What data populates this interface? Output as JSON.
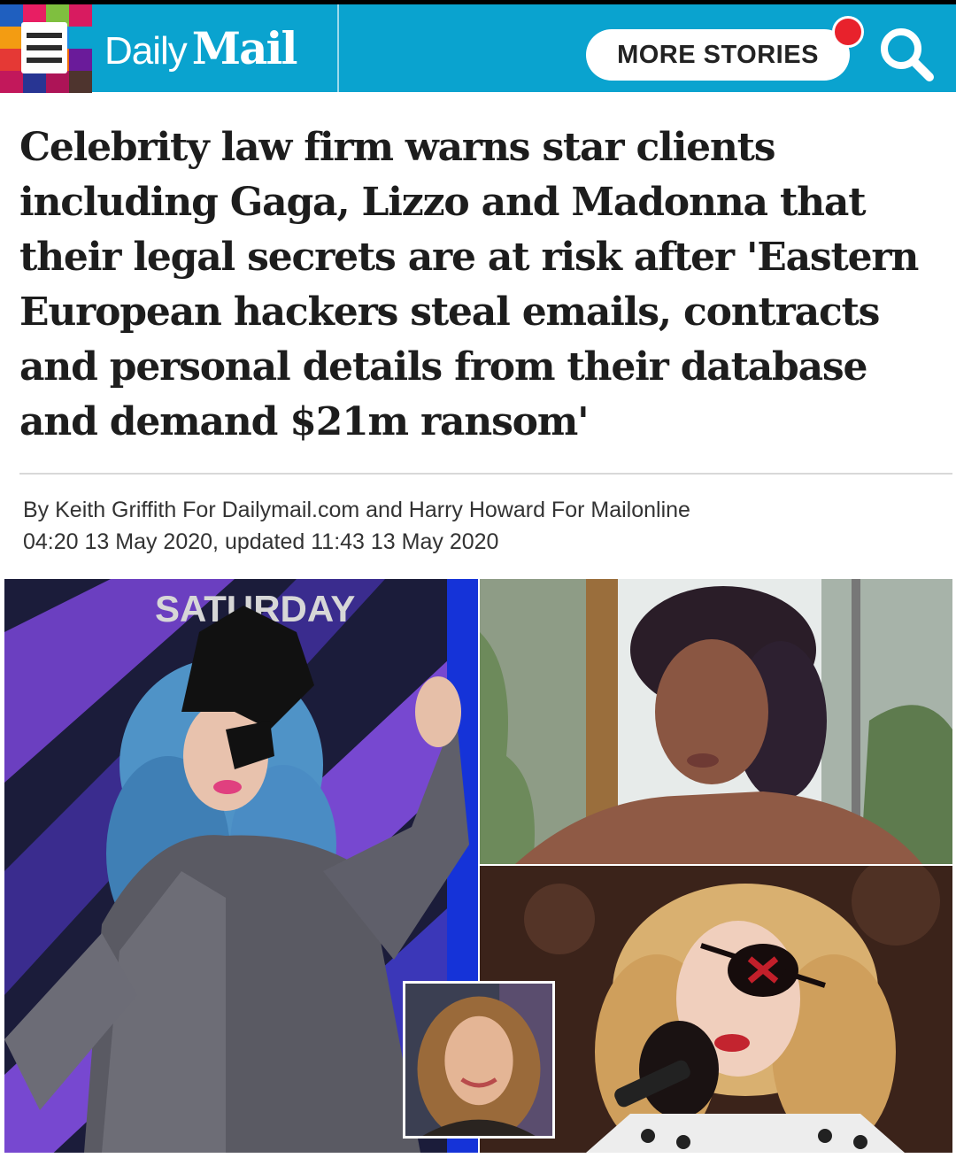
{
  "header": {
    "brand_daily": "Daily",
    "brand_mail": "Mail",
    "more_stories_label": "MORE STORIES",
    "accent_color": "#0aa3cf",
    "notification_color": "#e8222c"
  },
  "article": {
    "headline": "Celebrity law firm warns star clients including Gaga, Lizzo and Madonna that their legal secrets are at risk after 'Eastern European hackers steal emails, contracts and personal details from their database and demand $21m ransom'",
    "byline": "By Keith Griffith For Dailymail.com and Harry Howard For Mailonline",
    "dateline": "04:20 13 May 2020, updated 11:43 13 May 2020",
    "backdrop_text": "SATURDAY"
  },
  "icons": {
    "menu": "hamburger-icon",
    "search": "search-icon"
  }
}
